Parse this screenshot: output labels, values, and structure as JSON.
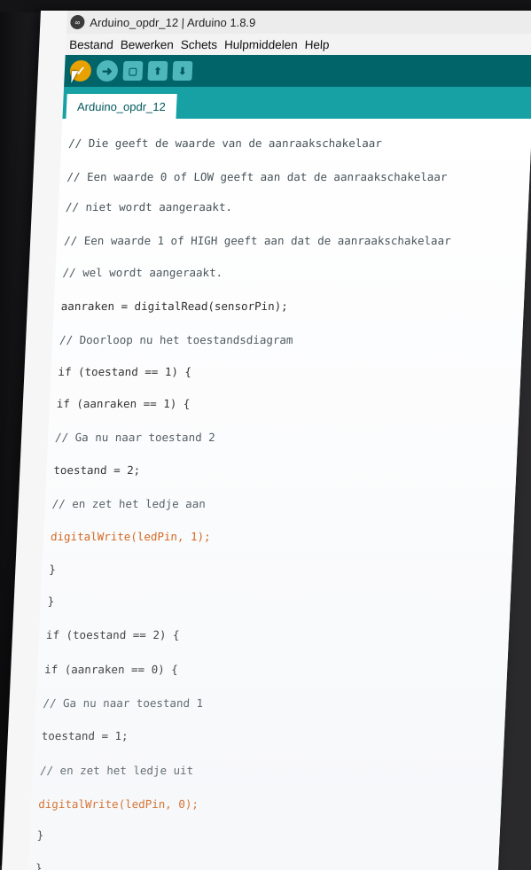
{
  "window": {
    "title": "Arduino_opdr_12 | Arduino 1.8.9"
  },
  "menu": [
    "Bestand",
    "Bewerken",
    "Schets",
    "Hulpmiddelen",
    "Help"
  ],
  "toolbar": {
    "buttons": [
      "verify-icon",
      "upload-icon",
      "new-icon",
      "open-icon",
      "save-icon"
    ]
  },
  "tabs": [
    {
      "label": "Arduino_opdr_12"
    }
  ],
  "code_lines": [
    "// Die geeft de waarde van de aanraakschakelaar",
    "// Een waarde 0 of LOW geeft aan dat de aanraakschakelaar",
    "// niet wordt aangeraakt.",
    "// Een waarde 1 of HIGH geeft aan dat de aanraakschakelaar",
    "// wel wordt aangeraakt.",
    "aanraken = digitalRead(sensorPin);",
    "// Doorloop nu het toestandsdiagram",
    "if (toestand == 1) {",
    "if (aanraken == 1) {",
    "// Ga nu naar toestand 2",
    "toestand = 2;",
    "// en zet het ledje aan",
    "digitalWrite(ledPin, 1);",
    "}",
    "}",
    "if (toestand == 2) {",
    "if (aanraken == 0) {",
    "// Ga nu naar toestand 1",
    "toestand = 1;",
    "// en zet het ledje uit",
    "digitalWrite(ledPin, 0);",
    "}",
    "}"
  ],
  "colors": {
    "toolbar": "#006468",
    "tabbar": "#17a1a5",
    "verify_button": "#e7a100",
    "keyword_function": "#d35400"
  }
}
